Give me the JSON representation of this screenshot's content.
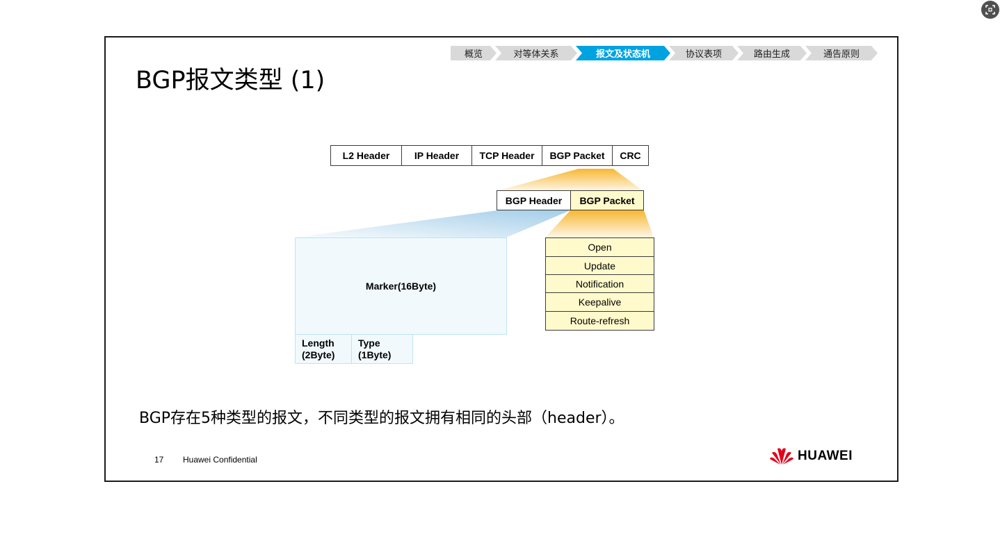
{
  "nav": {
    "items": [
      {
        "label": "概览",
        "active": false
      },
      {
        "label": "对等体关系",
        "active": false
      },
      {
        "label": "报文及状态机",
        "active": true
      },
      {
        "label": "协议表项",
        "active": false
      },
      {
        "label": "路由生成",
        "active": false
      },
      {
        "label": "通告原则",
        "active": false
      }
    ]
  },
  "slide": {
    "title": "BGP报文类型 (1)",
    "description": "BGP存在5种类型的报文，不同类型的报文拥有相同的头部（header）。",
    "page_number": "17",
    "confidential": "Huawei Confidential",
    "brand": "HUAWEI"
  },
  "diagram": {
    "frame": [
      "L2 Header",
      "IP Header",
      "TCP Header",
      "BGP Packet",
      "CRC"
    ],
    "bgp": {
      "header": "BGP Header",
      "packet": "BGP Packet"
    },
    "header_fields": {
      "marker": "Marker(16Byte)",
      "length_line1": "Length",
      "length_line2": "(2Byte)",
      "type_line1": "Type",
      "type_line2": "(1Byte)"
    },
    "types": [
      "Open",
      "Update",
      "Notification",
      "Keepalive",
      "Route-refresh"
    ]
  },
  "colors": {
    "nav_active": "#00a3e0",
    "nav_inactive": "#d9d9d9",
    "packet_yellow": "#fffacc",
    "fan_orange": "#f7b733",
    "fan_blue": "#9fcbe8",
    "brand_red": "#e3001b"
  }
}
